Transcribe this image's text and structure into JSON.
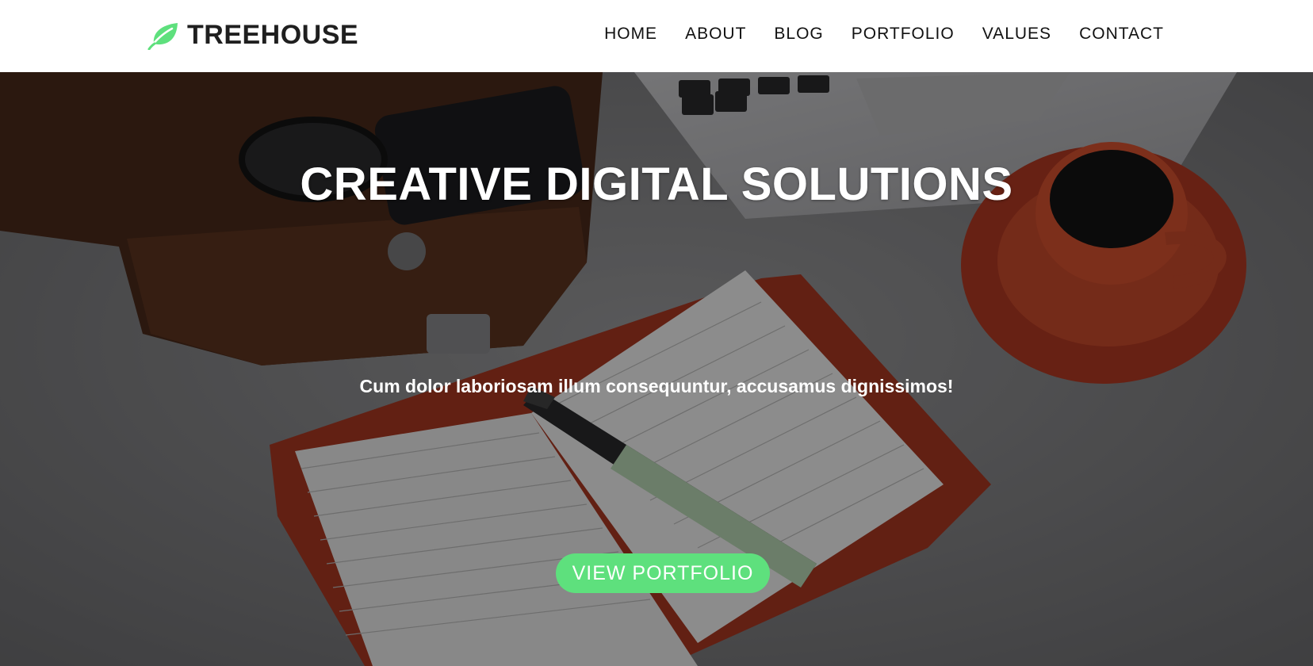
{
  "brand": {
    "name": "TREEHOUSE",
    "logo_icon": "leaf-icon",
    "accent_color": "#5ee07d"
  },
  "nav": {
    "items": [
      {
        "label": "HOME"
      },
      {
        "label": "ABOUT"
      },
      {
        "label": "BLOG"
      },
      {
        "label": "PORTFOLIO"
      },
      {
        "label": "VALUES"
      },
      {
        "label": "CONTACT"
      }
    ]
  },
  "hero": {
    "title": "CREATIVE DIGITAL SOLUTIONS",
    "subtitle": "Cum dolor laboriosam illum consequuntur, accusamus dignissimos!",
    "button_label": "VIEW PORTFOLIO",
    "button_color": "#5ee07d",
    "background_image": "desk-flatlay-photo"
  }
}
